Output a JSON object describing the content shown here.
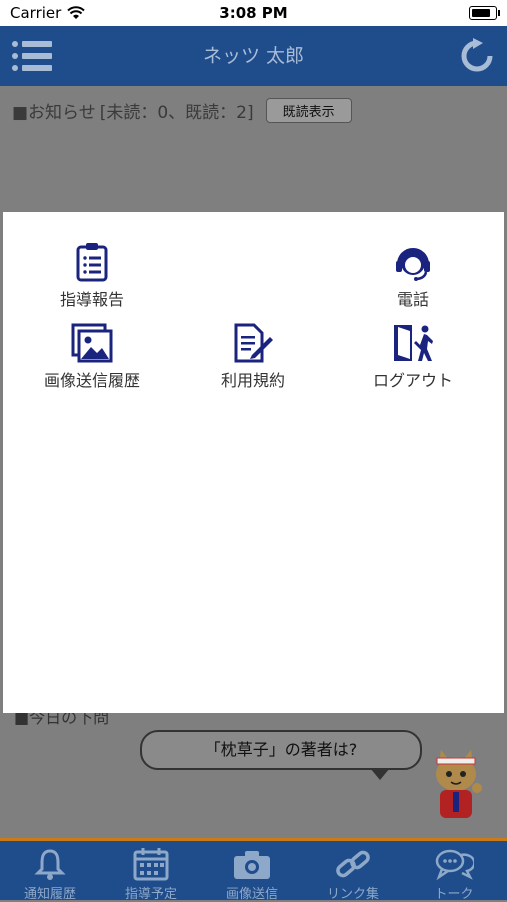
{
  "status_bar": {
    "carrier": "Carrier",
    "time": "3:08 PM"
  },
  "header": {
    "title": "ネッツ 太郎",
    "menu_icon": "list-icon",
    "refresh_icon": "refresh-icon"
  },
  "notice": {
    "prefix": "■お知らせ",
    "counts": "[未読：0、既読：2]",
    "read_button": "既読表示"
  },
  "behind_text": "■今日の下問",
  "bubble_text": "「枕草子」の著者は?",
  "menu": {
    "items": [
      {
        "label": "指導報告",
        "icon": "clipboard-icon"
      },
      {
        "label": "電話",
        "icon": "headset-icon"
      },
      {
        "label": "画像送信履歴",
        "icon": "image-icon"
      },
      {
        "label": "利用規約",
        "icon": "document-edit-icon"
      },
      {
        "label": "ログアウト",
        "icon": "logout-icon"
      }
    ]
  },
  "tabbar": {
    "tabs": [
      {
        "label": "通知履歴",
        "icon": "bell-icon"
      },
      {
        "label": "指導予定",
        "icon": "calendar-icon"
      },
      {
        "label": "画像送信",
        "icon": "camera-icon"
      },
      {
        "label": "リンク集",
        "icon": "link-icon"
      },
      {
        "label": "トーク",
        "icon": "chat-icon"
      }
    ]
  },
  "colors": {
    "primary": "#1f4d8c",
    "accent": "#c97b1a",
    "icon": "#1a237e"
  }
}
